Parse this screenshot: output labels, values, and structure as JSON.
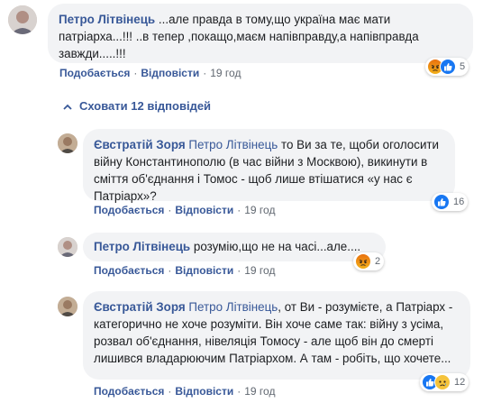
{
  "comments": [
    {
      "author": "Петро Літвінець",
      "mention": "",
      "text": "...але правда в тому,що україна має мати патріарха...!!! ..в тепер ,покащо,маєм напівправду,а напівправда завжди.....!!!",
      "like_label": "Подобається",
      "reply_label": "Відповісти",
      "time": "19 год",
      "reactions": [
        "angry",
        "like"
      ],
      "reaction_count": "5"
    },
    {
      "author": "Євстратій Зоря",
      "mention": "Петро Літвінець",
      "text": "то Ви за те, щоби оголосити війну Константинополю (в час війни з Москвою), викинути в сміття об'єднання і Томос - щоб лише втішатися «у нас є Патріарх»?",
      "like_label": "Подобається",
      "reply_label": "Відповісти",
      "time": "19 год",
      "reactions": [
        "like"
      ],
      "reaction_count": "16"
    },
    {
      "author": "Петро Літвінець",
      "mention": "",
      "text": "розумію,що не на часі...але....",
      "like_label": "Подобається",
      "reply_label": "Відповісти",
      "time": "19 год",
      "reactions": [
        "angry"
      ],
      "reaction_count": "2"
    },
    {
      "author": "Євстратій Зоря",
      "mention": "Петро Літвінець",
      "text": ", от Ви - розумієте, а Патріарх - категорично не хоче розуміти. Він хоче саме так: війну з усіма, розвал об'єднання, нівеляція Томосу - але щоб він до смерті лишився владарюючим Патріархом. А там - робіть, що хочете...",
      "like_label": "Подобається",
      "reply_label": "Відповісти",
      "time": "19 год",
      "reactions": [
        "like",
        "sad"
      ],
      "reaction_count": "12"
    }
  ],
  "hide_replies_label": "Сховати 12 відповідей",
  "colors": {
    "link": "#385898",
    "bubble": "#f2f3f5",
    "meta": "#606770",
    "like": "#1877f2",
    "angry": "#e9710f",
    "sad": "#f5c33b"
  }
}
